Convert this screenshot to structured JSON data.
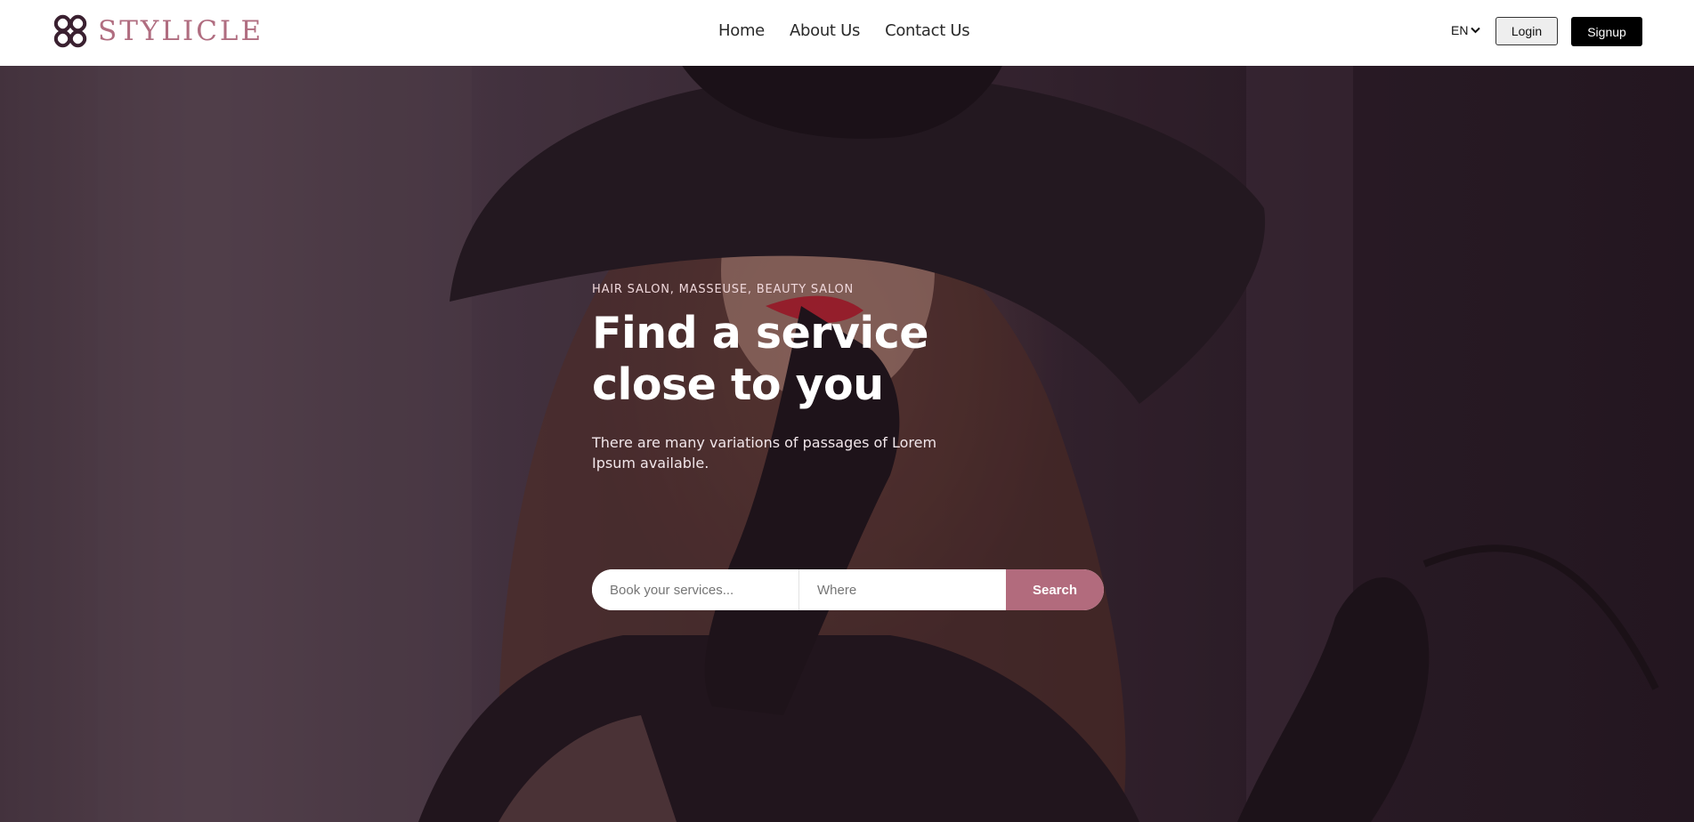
{
  "brand": {
    "name": "STYLICLE",
    "logo_icon": "interlocking-rings-logo-icon"
  },
  "nav": {
    "items": [
      {
        "label": "Home"
      },
      {
        "label": "About Us"
      },
      {
        "label": "Contact Us"
      }
    ]
  },
  "header": {
    "language": "EN",
    "login_label": "Login",
    "signup_label": "Signup"
  },
  "hero": {
    "eyebrow": "HAIR SALON, MASSEUSE, BEAUTY SALON",
    "headline": "Find a service close to you",
    "description": "There are many variations of passages of Lorem Ipsum available."
  },
  "search": {
    "service_placeholder": "Book your services...",
    "where_placeholder": "Where",
    "button_label": "Search"
  },
  "colors": {
    "accent": "#b26b7d",
    "brand": "#b06d80",
    "dark": "#000000"
  }
}
